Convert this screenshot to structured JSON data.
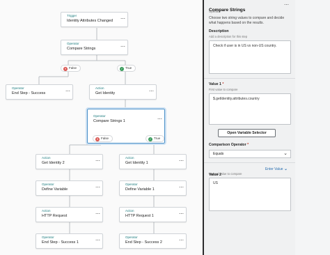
{
  "canvas": {
    "nodes": [
      {
        "id": "n1",
        "kind": "Trigger",
        "name": "Identity Attributes Changed"
      },
      {
        "id": "n2",
        "kind": "Operator",
        "name": "Compare Strings"
      },
      {
        "id": "n3",
        "kind": "Operator",
        "name": "End Step - Success"
      },
      {
        "id": "n4",
        "kind": "Action",
        "name": "Get Identity"
      },
      {
        "id": "n5",
        "kind": "Operator",
        "name": "Compare Strings 1"
      },
      {
        "id": "n6",
        "kind": "Action",
        "name": "Get Identity 2"
      },
      {
        "id": "n7",
        "kind": "Action",
        "name": "Get Identity 1"
      },
      {
        "id": "n8",
        "kind": "Operator",
        "name": "Define Variable"
      },
      {
        "id": "n9",
        "kind": "Operator",
        "name": "Define Variable 1"
      },
      {
        "id": "n10",
        "kind": "Action",
        "name": "HTTP Request"
      },
      {
        "id": "n11",
        "kind": "Action",
        "name": "HTTP Request 1"
      },
      {
        "id": "n12",
        "kind": "Operator",
        "name": "End Step - Success 1"
      },
      {
        "id": "n13",
        "kind": "Operator",
        "name": "End Step - Success 2"
      }
    ],
    "node_menu_icon": "ellipsis-icon",
    "branch_pills": [
      {
        "label": "False",
        "status": "false"
      },
      {
        "label": "True",
        "status": "true"
      },
      {
        "label": "False",
        "status": "false"
      },
      {
        "label": "True",
        "status": "true"
      }
    ],
    "colors": {
      "false": "#d9534f",
      "true": "#3a9b5c",
      "selected": "#4a90c8",
      "kind": "#1a7b7e"
    }
  },
  "panel": {
    "title": "Compare Strings",
    "subtitle": "Operator",
    "description_text": "Choose two string values to compare and decide what happens based on the results.",
    "description": {
      "label": "Description",
      "hint": "Add a description for this step",
      "value": "Check if user is in US vs non-US country."
    },
    "value1": {
      "label": "Value 1",
      "required_mark": "*",
      "hint": "First value to compare",
      "value": "$.getIdentity.attributes.country"
    },
    "variable_selector_label": "Open Variable Selector",
    "comparison": {
      "label": "Comparison Operator",
      "required_mark": "*",
      "selected": "Equals"
    },
    "value2": {
      "label": "Value 2",
      "enter_value_label": "Enter Value",
      "hint": "Second value to compare",
      "value": "US"
    }
  }
}
